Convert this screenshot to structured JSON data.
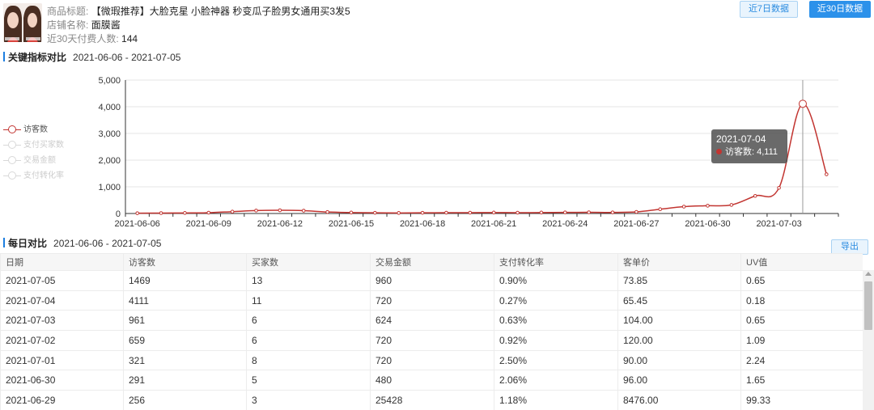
{
  "product": {
    "title_label": "商品标题:",
    "title_value": "【微瑕推荐】大脸克星 小脸神器 秒变瓜子脸男女通用买3发5",
    "shop_label": "店铺名称:",
    "shop_value": "面膜酱",
    "buyers_label": "近30天付费人数:",
    "buyers_value": "144"
  },
  "range_buttons": {
    "last7": "近7日数据",
    "last30": "近30日数据"
  },
  "key_metrics": {
    "title": "关键指标对比",
    "date_range": "2021-06-06 - 2021-07-05"
  },
  "legend": [
    "访客数",
    "支付买家数",
    "交易金额",
    "支付转化率"
  ],
  "tooltip": {
    "date": "2021-07-04",
    "label": "访客数: 4,111"
  },
  "daily": {
    "title": "每日对比",
    "date_range": "2021-06-06 - 2021-07-05",
    "export_label": "导出"
  },
  "colors": {
    "accent": "#2c91ea",
    "series": "#c23531"
  },
  "table": {
    "columns": [
      "日期",
      "访客数",
      "买家数",
      "交易金额",
      "支付转化率",
      "客单价",
      "UV值"
    ],
    "rows": [
      [
        "2021-07-05",
        "1469",
        "13",
        "960",
        "0.90%",
        "73.85",
        "0.65"
      ],
      [
        "2021-07-04",
        "4111",
        "11",
        "720",
        "0.27%",
        "65.45",
        "0.18"
      ],
      [
        "2021-07-03",
        "961",
        "6",
        "624",
        "0.63%",
        "104.00",
        "0.65"
      ],
      [
        "2021-07-02",
        "659",
        "6",
        "720",
        "0.92%",
        "120.00",
        "1.09"
      ],
      [
        "2021-07-01",
        "321",
        "8",
        "720",
        "2.50%",
        "90.00",
        "2.24"
      ],
      [
        "2021-06-30",
        "291",
        "5",
        "480",
        "2.06%",
        "96.00",
        "1.65"
      ],
      [
        "2021-06-29",
        "256",
        "3",
        "25428",
        "1.18%",
        "8476.00",
        "99.33"
      ]
    ]
  },
  "chart_data": {
    "type": "line",
    "x": [
      "2021-06-06",
      "2021-06-07",
      "2021-06-08",
      "2021-06-09",
      "2021-06-10",
      "2021-06-11",
      "2021-06-12",
      "2021-06-13",
      "2021-06-14",
      "2021-06-15",
      "2021-06-16",
      "2021-06-17",
      "2021-06-18",
      "2021-06-19",
      "2021-06-20",
      "2021-06-21",
      "2021-06-22",
      "2021-06-23",
      "2021-06-24",
      "2021-06-25",
      "2021-06-26",
      "2021-06-27",
      "2021-06-28",
      "2021-06-29",
      "2021-06-30",
      "2021-07-01",
      "2021-07-02",
      "2021-07-03",
      "2021-07-04",
      "2021-07-05"
    ],
    "x_tick_labels": [
      "2021-06-06",
      "2021-06-09",
      "2021-06-12",
      "2021-06-15",
      "2021-06-18",
      "2021-06-21",
      "2021-06-24",
      "2021-06-27",
      "2021-06-30",
      "2021-07-03"
    ],
    "y_tick_labels": [
      "0",
      "1,000",
      "2,000",
      "3,000",
      "4,000",
      "5,000"
    ],
    "ylim": [
      0,
      5000
    ],
    "highlight_date": "2021-07-04",
    "series": [
      {
        "name": "访客数",
        "values": [
          10,
          15,
          20,
          30,
          70,
          110,
          120,
          105,
          55,
          35,
          25,
          20,
          25,
          30,
          30,
          35,
          30,
          35,
          40,
          45,
          40,
          60,
          160,
          256,
          291,
          321,
          659,
          961,
          4111,
          1469
        ]
      }
    ]
  }
}
